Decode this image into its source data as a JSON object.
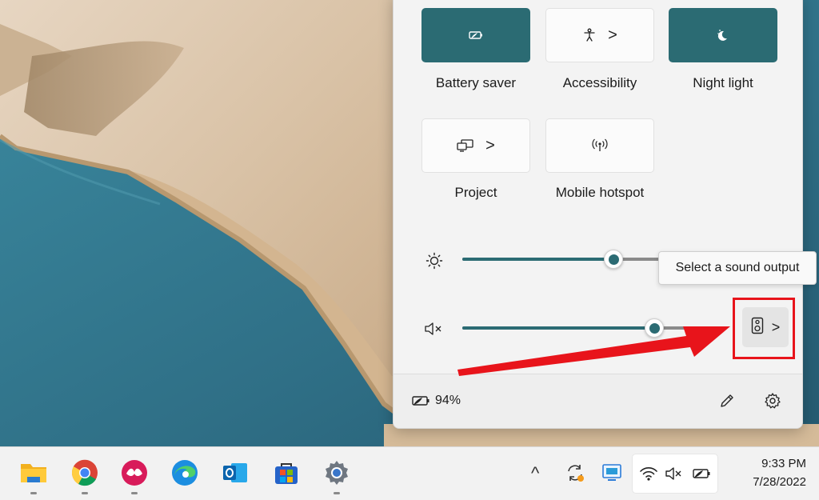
{
  "quick_settings": {
    "tiles": [
      {
        "label": "Battery saver",
        "active": true,
        "icon": "battery-saver-icon"
      },
      {
        "label": "Accessibility",
        "active": false,
        "icon": "accessibility-icon",
        "chevron": ">"
      },
      {
        "label": "Night light",
        "active": true,
        "icon": "night-light-icon"
      },
      {
        "label": "Project",
        "active": false,
        "icon": "project-icon",
        "chevron": ">"
      },
      {
        "label": "Mobile hotspot",
        "active": false,
        "icon": "hotspot-icon"
      }
    ],
    "brightness": {
      "icon": "sun-icon",
      "level_fraction": 0.74
    },
    "volume": {
      "icon": "speaker-muted-icon",
      "muted": true,
      "level_fraction": 0.8
    },
    "sound_output": {
      "icon": "speaker-device-icon",
      "chevron": ">",
      "tooltip": "Select a sound output"
    },
    "footer": {
      "battery_icon": "battery-charging-icon",
      "battery_percent": "94%",
      "edit_icon": "pencil-icon",
      "settings_icon": "gear-icon"
    }
  },
  "annotation": {
    "color": "#e8141b",
    "type": "arrow-and-box"
  },
  "taskbar": {
    "apps": [
      "file-explorer-icon",
      "chrome-icon",
      "pdf-reader-icon",
      "edge-icon",
      "outlook-icon",
      "store-icon",
      "settings-icon"
    ],
    "tray": {
      "overflow_chevron": "^",
      "icons": [
        "sync-icon",
        "display-icon",
        "wifi-icon",
        "speaker-muted-icon",
        "battery-charging-icon"
      ]
    },
    "clock": {
      "time": "9:33 PM",
      "date": "7/28/2022"
    }
  },
  "colors": {
    "accent": "#2b6b73",
    "panel": "#f3f3f3",
    "taskbar": "#f2f2f2"
  }
}
